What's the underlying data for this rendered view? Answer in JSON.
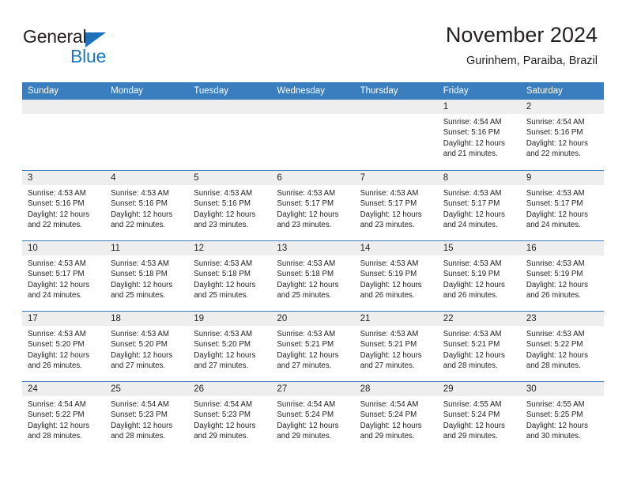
{
  "brand": {
    "name_top": "General",
    "name_bottom": "Blue",
    "triangle_color": "#1c71b8",
    "blue_color": "#1c79c0"
  },
  "header": {
    "title": "November 2024",
    "subtitle": "Gurinhem, Paraiba, Brazil"
  },
  "theme": {
    "header_blue": "#3a7ebf",
    "banner_gray": "#eeeeee",
    "text": "#231f20"
  },
  "weekdays": [
    "Sunday",
    "Monday",
    "Tuesday",
    "Wednesday",
    "Thursday",
    "Friday",
    "Saturday"
  ],
  "weeks": [
    [
      {
        "day": "",
        "lines": []
      },
      {
        "day": "",
        "lines": []
      },
      {
        "day": "",
        "lines": []
      },
      {
        "day": "",
        "lines": []
      },
      {
        "day": "",
        "lines": []
      },
      {
        "day": "1",
        "lines": [
          "Sunrise: 4:54 AM",
          "Sunset: 5:16 PM",
          "Daylight: 12 hours",
          "and 21 minutes."
        ]
      },
      {
        "day": "2",
        "lines": [
          "Sunrise: 4:54 AM",
          "Sunset: 5:16 PM",
          "Daylight: 12 hours",
          "and 22 minutes."
        ]
      }
    ],
    [
      {
        "day": "3",
        "lines": [
          "Sunrise: 4:53 AM",
          "Sunset: 5:16 PM",
          "Daylight: 12 hours",
          "and 22 minutes."
        ]
      },
      {
        "day": "4",
        "lines": [
          "Sunrise: 4:53 AM",
          "Sunset: 5:16 PM",
          "Daylight: 12 hours",
          "and 22 minutes."
        ]
      },
      {
        "day": "5",
        "lines": [
          "Sunrise: 4:53 AM",
          "Sunset: 5:16 PM",
          "Daylight: 12 hours",
          "and 23 minutes."
        ]
      },
      {
        "day": "6",
        "lines": [
          "Sunrise: 4:53 AM",
          "Sunset: 5:17 PM",
          "Daylight: 12 hours",
          "and 23 minutes."
        ]
      },
      {
        "day": "7",
        "lines": [
          "Sunrise: 4:53 AM",
          "Sunset: 5:17 PM",
          "Daylight: 12 hours",
          "and 23 minutes."
        ]
      },
      {
        "day": "8",
        "lines": [
          "Sunrise: 4:53 AM",
          "Sunset: 5:17 PM",
          "Daylight: 12 hours",
          "and 24 minutes."
        ]
      },
      {
        "day": "9",
        "lines": [
          "Sunrise: 4:53 AM",
          "Sunset: 5:17 PM",
          "Daylight: 12 hours",
          "and 24 minutes."
        ]
      }
    ],
    [
      {
        "day": "10",
        "lines": [
          "Sunrise: 4:53 AM",
          "Sunset: 5:17 PM",
          "Daylight: 12 hours",
          "and 24 minutes."
        ]
      },
      {
        "day": "11",
        "lines": [
          "Sunrise: 4:53 AM",
          "Sunset: 5:18 PM",
          "Daylight: 12 hours",
          "and 25 minutes."
        ]
      },
      {
        "day": "12",
        "lines": [
          "Sunrise: 4:53 AM",
          "Sunset: 5:18 PM",
          "Daylight: 12 hours",
          "and 25 minutes."
        ]
      },
      {
        "day": "13",
        "lines": [
          "Sunrise: 4:53 AM",
          "Sunset: 5:18 PM",
          "Daylight: 12 hours",
          "and 25 minutes."
        ]
      },
      {
        "day": "14",
        "lines": [
          "Sunrise: 4:53 AM",
          "Sunset: 5:19 PM",
          "Daylight: 12 hours",
          "and 26 minutes."
        ]
      },
      {
        "day": "15",
        "lines": [
          "Sunrise: 4:53 AM",
          "Sunset: 5:19 PM",
          "Daylight: 12 hours",
          "and 26 minutes."
        ]
      },
      {
        "day": "16",
        "lines": [
          "Sunrise: 4:53 AM",
          "Sunset: 5:19 PM",
          "Daylight: 12 hours",
          "and 26 minutes."
        ]
      }
    ],
    [
      {
        "day": "17",
        "lines": [
          "Sunrise: 4:53 AM",
          "Sunset: 5:20 PM",
          "Daylight: 12 hours",
          "and 26 minutes."
        ]
      },
      {
        "day": "18",
        "lines": [
          "Sunrise: 4:53 AM",
          "Sunset: 5:20 PM",
          "Daylight: 12 hours",
          "and 27 minutes."
        ]
      },
      {
        "day": "19",
        "lines": [
          "Sunrise: 4:53 AM",
          "Sunset: 5:20 PM",
          "Daylight: 12 hours",
          "and 27 minutes."
        ]
      },
      {
        "day": "20",
        "lines": [
          "Sunrise: 4:53 AM",
          "Sunset: 5:21 PM",
          "Daylight: 12 hours",
          "and 27 minutes."
        ]
      },
      {
        "day": "21",
        "lines": [
          "Sunrise: 4:53 AM",
          "Sunset: 5:21 PM",
          "Daylight: 12 hours",
          "and 27 minutes."
        ]
      },
      {
        "day": "22",
        "lines": [
          "Sunrise: 4:53 AM",
          "Sunset: 5:21 PM",
          "Daylight: 12 hours",
          "and 28 minutes."
        ]
      },
      {
        "day": "23",
        "lines": [
          "Sunrise: 4:53 AM",
          "Sunset: 5:22 PM",
          "Daylight: 12 hours",
          "and 28 minutes."
        ]
      }
    ],
    [
      {
        "day": "24",
        "lines": [
          "Sunrise: 4:54 AM",
          "Sunset: 5:22 PM",
          "Daylight: 12 hours",
          "and 28 minutes."
        ]
      },
      {
        "day": "25",
        "lines": [
          "Sunrise: 4:54 AM",
          "Sunset: 5:23 PM",
          "Daylight: 12 hours",
          "and 28 minutes."
        ]
      },
      {
        "day": "26",
        "lines": [
          "Sunrise: 4:54 AM",
          "Sunset: 5:23 PM",
          "Daylight: 12 hours",
          "and 29 minutes."
        ]
      },
      {
        "day": "27",
        "lines": [
          "Sunrise: 4:54 AM",
          "Sunset: 5:24 PM",
          "Daylight: 12 hours",
          "and 29 minutes."
        ]
      },
      {
        "day": "28",
        "lines": [
          "Sunrise: 4:54 AM",
          "Sunset: 5:24 PM",
          "Daylight: 12 hours",
          "and 29 minutes."
        ]
      },
      {
        "day": "29",
        "lines": [
          "Sunrise: 4:55 AM",
          "Sunset: 5:24 PM",
          "Daylight: 12 hours",
          "and 29 minutes."
        ]
      },
      {
        "day": "30",
        "lines": [
          "Sunrise: 4:55 AM",
          "Sunset: 5:25 PM",
          "Daylight: 12 hours",
          "and 30 minutes."
        ]
      }
    ]
  ]
}
